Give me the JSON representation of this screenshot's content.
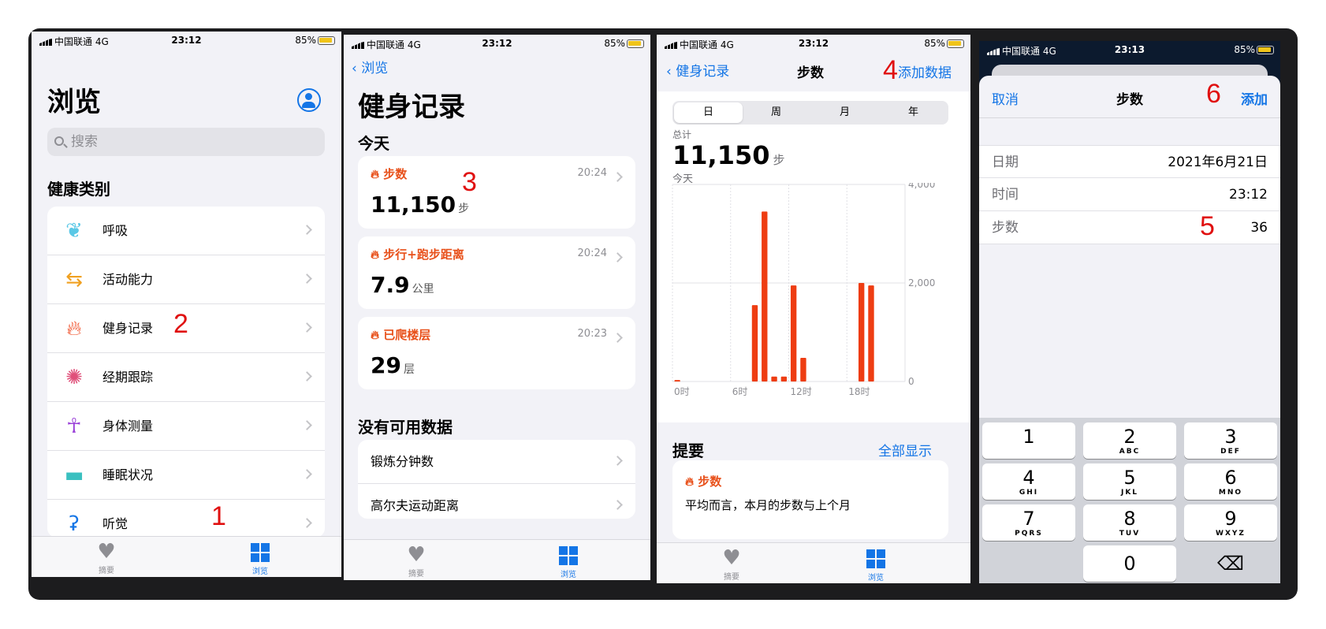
{
  "status": {
    "carrier": "中国联通 4G",
    "time1": "23:12",
    "time4": "23:13",
    "battery": "85%"
  },
  "phone1": {
    "title": "浏览",
    "search_placeholder": "搜索",
    "section": "健康类别",
    "items": [
      {
        "label": "呼吸",
        "icon": "lungs-icon"
      },
      {
        "label": "活动能力",
        "icon": "arrows-icon"
      },
      {
        "label": "健身记录",
        "icon": "flame-icon"
      },
      {
        "label": "经期跟踪",
        "icon": "cycle-icon"
      },
      {
        "label": "身体测量",
        "icon": "figure-icon"
      },
      {
        "label": "睡眠状况",
        "icon": "bed-icon"
      },
      {
        "label": "听觉",
        "icon": "ear-icon"
      }
    ],
    "tab_summary": "摘要",
    "tab_browse": "浏览",
    "marker1": "1",
    "marker2": "2"
  },
  "phone2": {
    "back": "浏览",
    "title": "健身记录",
    "today": "今天",
    "cards": [
      {
        "title": "步数",
        "time": "20:24",
        "value": "11,150",
        "unit": "步"
      },
      {
        "title": "步行+跑步距离",
        "time": "20:24",
        "value": "7.9",
        "unit": "公里"
      },
      {
        "title": "已爬楼层",
        "time": "20:23",
        "value": "29",
        "unit": "层"
      }
    ],
    "no_data": "没有可用数据",
    "no_data_items": [
      "锻炼分钟数",
      "高尔夫运动距离"
    ],
    "tab_summary": "摘要",
    "tab_browse": "浏览",
    "marker3": "3"
  },
  "phone3": {
    "back": "健身记录",
    "title": "步数",
    "add": "添加数据",
    "segments": [
      "日",
      "周",
      "月",
      "年"
    ],
    "total_label": "总计",
    "total_value": "11,150",
    "total_unit": "步",
    "period": "今天",
    "highlights": "提要",
    "show_all": "全部显示",
    "hl_card_title": "步数",
    "hl_card_text": "平均而言，本月的步数与上个月",
    "tab_summary": "摘要",
    "tab_browse": "浏览",
    "marker4": "4",
    "accent": "#ee3d12"
  },
  "chart_data": {
    "type": "bar",
    "title": "",
    "xlabel": "",
    "ylabel": "",
    "x_ticks": [
      "0时",
      "6时",
      "12时",
      "18时"
    ],
    "y_ticks": [
      "4,000",
      "2,000",
      "0"
    ],
    "ylim": [
      0,
      4000
    ],
    "categories": [
      "0",
      "1",
      "2",
      "3",
      "4",
      "5",
      "6",
      "7",
      "8",
      "9",
      "10",
      "11",
      "12",
      "13",
      "14",
      "15",
      "16",
      "17",
      "18",
      "19",
      "20",
      "21",
      "22",
      "23"
    ],
    "values": [
      30,
      0,
      0,
      0,
      0,
      0,
      0,
      0,
      1550,
      3450,
      100,
      100,
      1950,
      480,
      0,
      0,
      0,
      0,
      0,
      2000,
      1950,
      0,
      0,
      0
    ],
    "grid": true
  },
  "phone4": {
    "cancel": "取消",
    "title": "步数",
    "add": "添加",
    "rows": [
      {
        "key": "日期",
        "value": "2021年6月21日"
      },
      {
        "key": "时间",
        "value": "23:12"
      },
      {
        "key": "步数",
        "value": "36"
      }
    ],
    "keys": [
      {
        "n": "1",
        "l": ""
      },
      {
        "n": "2",
        "l": "ABC"
      },
      {
        "n": "3",
        "l": "DEF"
      },
      {
        "n": "4",
        "l": "GHI"
      },
      {
        "n": "5",
        "l": "JKL"
      },
      {
        "n": "6",
        "l": "MNO"
      },
      {
        "n": "7",
        "l": "PQRS"
      },
      {
        "n": "8",
        "l": "TUV"
      },
      {
        "n": "9",
        "l": "WXYZ"
      },
      {
        "n": "0",
        "l": ""
      }
    ],
    "backspace": "⌫",
    "marker5": "5",
    "marker6": "6"
  }
}
